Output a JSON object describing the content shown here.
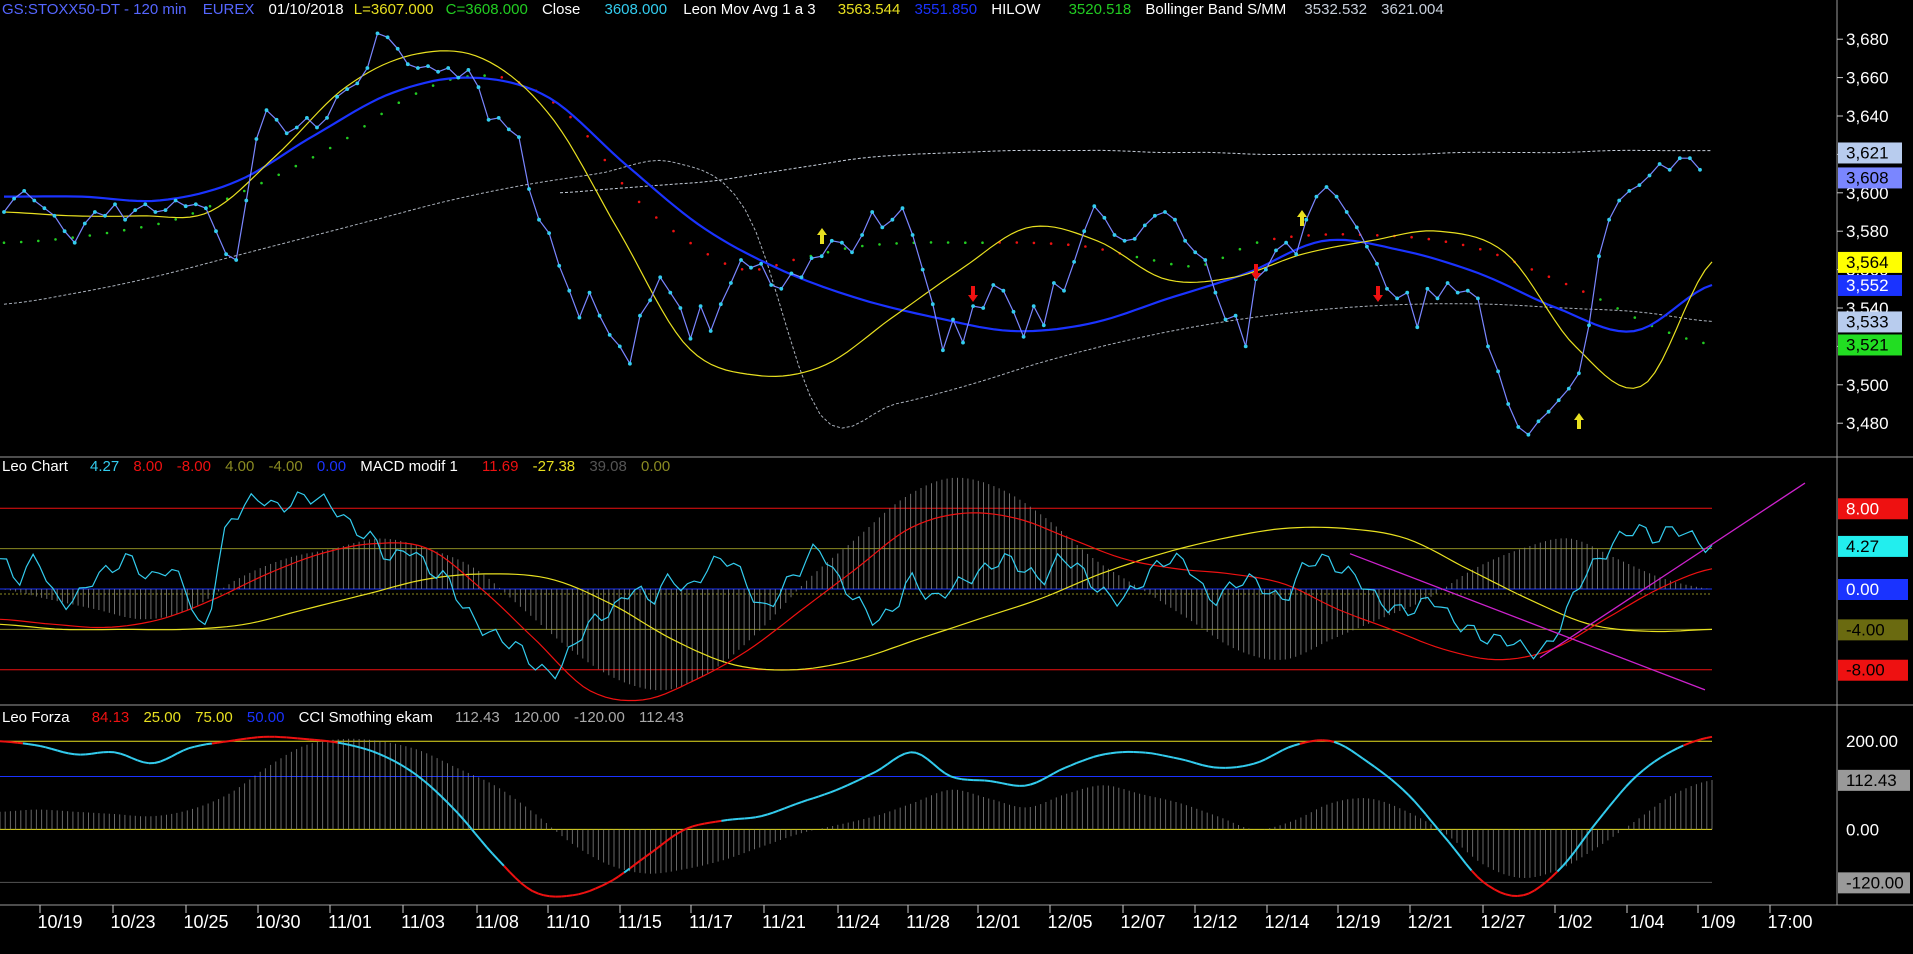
{
  "header": {
    "symbol": "GS:STOXX50-DT - 120 min",
    "exchange": "EUREX",
    "date": "01/10/2018",
    "low": "L=3607.000",
    "close_label": "C=3608.000",
    "close_word": "Close",
    "close_value": "3608.000",
    "ma_name": "Leon Mov Avg 1 a 3",
    "ma_v1": "3563.544",
    "ma_v2": "3551.850",
    "hilow_name": "HILOW",
    "hilow_v": "3520.518",
    "bb_name": "Bollinger Band S/MM",
    "bb_v1": "3532.532",
    "bb_v2": "3621.004"
  },
  "panel2_header": {
    "name": "Leo Chart",
    "v1": "4.27",
    "v2": "8.00",
    "v3": "-8.00",
    "v4": "4.00",
    "v5": "-4.00",
    "v6": "0.00",
    "macd_name": "MACD modif 1",
    "m1": "11.69",
    "m2": "-27.38",
    "m3": "39.08",
    "m4": "0.00"
  },
  "panel3_header": {
    "name": "Leo Forza",
    "v1": "84.13",
    "v2": "25.00",
    "v3": "75.00",
    "v4": "50.00",
    "cci_name": "CCI Smothing ekam",
    "c1": "112.43",
    "c2": "120.00",
    "c3": "-120.00",
    "c4": "112.43"
  },
  "colors": {
    "close": "#33ccee",
    "ma_yellow": "#e8e020",
    "ma_blue": "#1a33ff",
    "hilow_red": "#ee1111",
    "hilow_green": "#22cc22",
    "bb": "#c8d0dc",
    "header_blue": "#5566ff",
    "magenta": "#cc22cc",
    "hist": "#888888"
  },
  "chart_data": [
    {
      "type": "line",
      "title": "GS:STOXX50-DT - 120 min",
      "x_ticks": [
        "10/19",
        "10/23",
        "10/25",
        "10/30",
        "11/01",
        "11/03",
        "11/08",
        "11/10",
        "11/15",
        "11/17",
        "11/21",
        "11/24",
        "11/28",
        "12/01",
        "12/05",
        "12/07",
        "12/12",
        "12/14",
        "12/19",
        "12/21",
        "12/27",
        "1/02",
        "1/04",
        "1/09",
        "17:00"
      ],
      "y_ticks": [
        "3,480",
        "3,500",
        "3,520",
        "3,540",
        "3,560",
        "3,580",
        "3,600",
        "3,620",
        "3,640",
        "3,660",
        "3,680"
      ],
      "ylim": [
        3465,
        3690
      ],
      "badges": [
        "3,621",
        "3,608",
        "3,564",
        "3,552",
        "3,533",
        "3,521"
      ],
      "close": [
        3590,
        3597,
        3601,
        3596,
        3592,
        3588,
        3580,
        3574,
        3584,
        3590,
        3588,
        3594,
        3586,
        3591,
        3594,
        3590,
        3591,
        3596,
        3593,
        3594,
        3592,
        3580,
        3568,
        3565,
        3596,
        3628,
        3643,
        3638,
        3631,
        3634,
        3639,
        3634,
        3639,
        3650,
        3654,
        3657,
        3665,
        3683,
        3681,
        3675,
        3667,
        3665,
        3666,
        3663,
        3665,
        3660,
        3664,
        3655,
        3638,
        3639,
        3633,
        3629,
        3602,
        3586,
        3579,
        3562,
        3549,
        3535,
        3548,
        3536,
        3526,
        3520,
        3511,
        3536,
        3544,
        3556,
        3548,
        3540,
        3524,
        3541,
        3528,
        3542,
        3553,
        3565,
        3561,
        3563,
        3552,
        3550,
        3558,
        3556,
        3566,
        3567,
        3575,
        3574,
        3569,
        3578,
        3590,
        3582,
        3586,
        3592,
        3578,
        3560,
        3542,
        3518,
        3534,
        3522,
        3541,
        3540,
        3552,
        3549,
        3538,
        3525,
        3541,
        3531,
        3553,
        3549,
        3564,
        3580,
        3593,
        3587,
        3578,
        3575,
        3576,
        3583,
        3588,
        3590,
        3586,
        3575,
        3569,
        3565,
        3548,
        3534,
        3536,
        3520,
        3555,
        3560,
        3570,
        3574,
        3568,
        3586,
        3598,
        3603,
        3598,
        3590,
        3582,
        3572,
        3563,
        3550,
        3545,
        3548,
        3530,
        3550,
        3545,
        3553,
        3548,
        3549,
        3545,
        3520,
        3507,
        3490,
        3478,
        3474,
        3481,
        3486,
        3492,
        3498,
        3506,
        3531,
        3567,
        3586,
        3596,
        3601,
        3604,
        3609,
        3615,
        3612,
        3618,
        3618,
        3612
      ],
      "bollinger_upper": [
        3600,
        3602,
        3604,
        3606,
        3610,
        3614,
        3618,
        3620,
        3621,
        3622,
        3622,
        3622,
        3621,
        3621,
        3620,
        3620,
        3620,
        3620,
        3621,
        3621,
        3621,
        3622,
        3622,
        3622
      ],
      "bollinger_lower": [
        3542,
        3548,
        3556,
        3566,
        3576,
        3586,
        3596,
        3604,
        3610,
        3616,
        3590,
        3484,
        3490,
        3500,
        3512,
        3522,
        3530,
        3536,
        3540,
        3542,
        3542,
        3540,
        3538,
        3533
      ],
      "ma_fast": [
        3590,
        3588,
        3588,
        3590,
        3620,
        3655,
        3672,
        3670,
        3640,
        3580,
        3520,
        3505,
        3510,
        3535,
        3560,
        3582,
        3575,
        3555,
        3556,
        3568,
        3575,
        3580,
        3568,
        3520,
        3500,
        3564
      ],
      "ma_slow": [
        3598,
        3598,
        3596,
        3606,
        3630,
        3652,
        3660,
        3650,
        3615,
        3582,
        3560,
        3545,
        3535,
        3528,
        3532,
        3545,
        3558,
        3575,
        3570,
        3558,
        3540,
        3528,
        3552
      ]
    },
    {
      "type": "line",
      "title": "Leo Chart / MACD modif 1",
      "y_ticks": [
        "8.00",
        "4.27",
        "0.00",
        "-4.00",
        "-8.00"
      ],
      "levels": [
        8,
        4,
        0,
        -4,
        -8
      ],
      "ylim": [
        -11,
        11
      ]
    },
    {
      "type": "line",
      "title": "Leo Forza / CCI Smothing ekam",
      "y_ticks": [
        "200.00",
        "112.43",
        "0.00",
        "-120.00"
      ],
      "levels": [
        200,
        120,
        0,
        -120
      ],
      "ylim": [
        -160,
        230
      ]
    }
  ]
}
